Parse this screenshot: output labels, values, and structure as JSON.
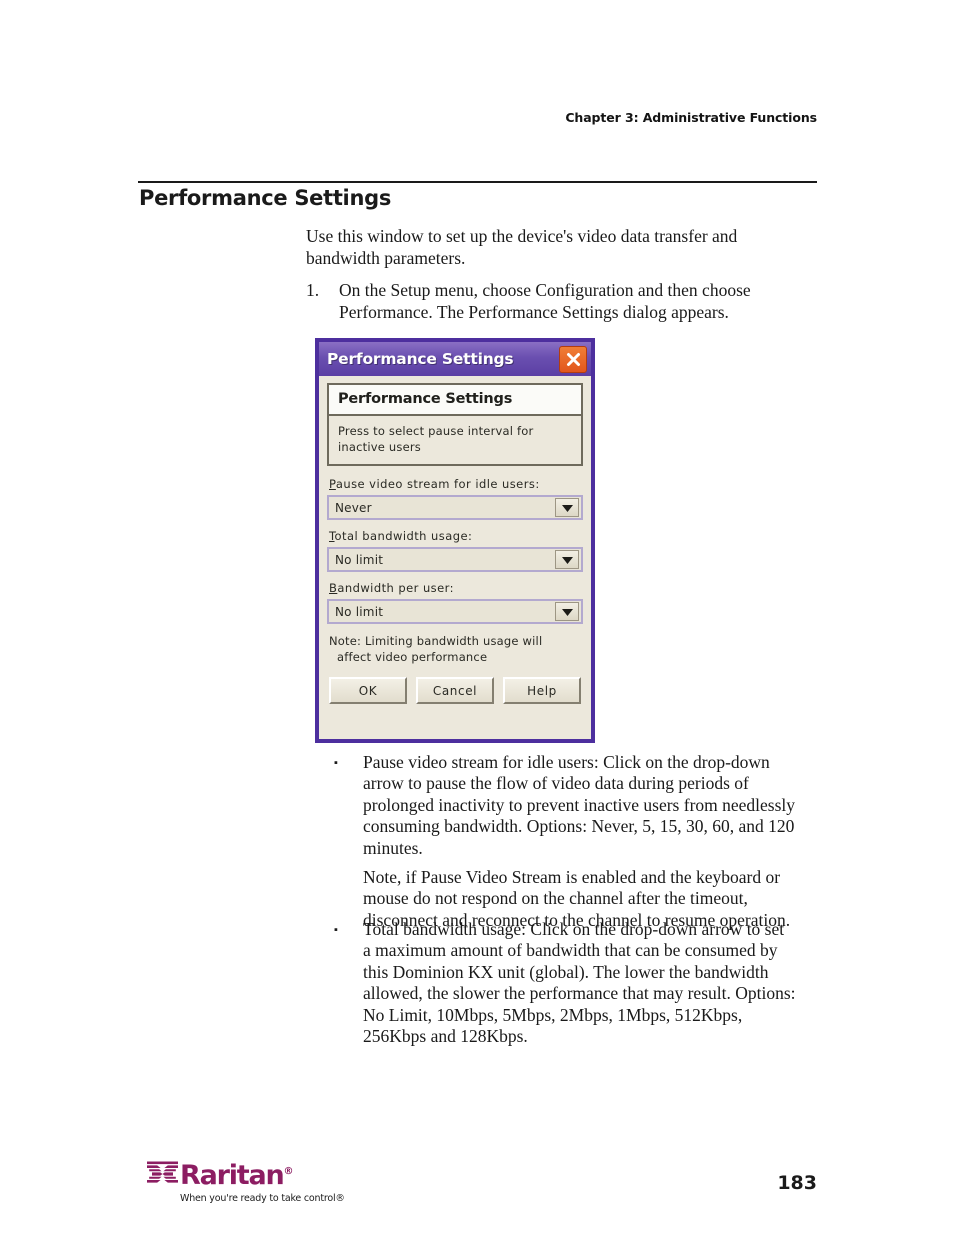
{
  "page": {
    "running_head": "Chapter 3: Administrative Functions",
    "section_title": "Performance Settings",
    "page_number": "183"
  },
  "body": {
    "intro": "Use this window to set up the device's video data transfer and bandwidth parameters.",
    "step_number": "1.",
    "step_text": "On the Setup menu, choose Configuration and then choose Performance. The Performance Settings dialog appears.",
    "bullets": [
      {
        "marker": "▪",
        "text": "Pause video stream for idle users: Click on the drop-down arrow to pause the flow of video data during periods of prolonged inactivity to prevent inactive users from needlessly consuming bandwidth. Options: Never, 5, 15, 30, 60, and 120 minutes.",
        "note": "Note, if Pause Video Stream is enabled and the keyboard or mouse do not respond on the channel after the timeout, disconnect and reconnect to the channel to resume operation."
      },
      {
        "marker": "▪",
        "text": "Total bandwidth usage: Click on the drop-down arrow to set a maximum amount of bandwidth that can be consumed by this Dominion KX unit (global). The lower the bandwidth allowed, the slower the performance that may result. Options: No Limit, 10Mbps, 5Mbps, 2Mbps, 1Mbps, 512Kbps, 256Kbps and 128Kbps."
      }
    ]
  },
  "dialog": {
    "titlebar": {
      "title": "Performance Settings",
      "close_icon": "close-x-icon"
    },
    "panel": {
      "heading": "Performance Settings",
      "hint": "Press to select pause interval for inactive users"
    },
    "fields": [
      {
        "mnemonic": "P",
        "label_rest": "ause video stream for idle users:",
        "value": "Never",
        "arrow_icon": "chevron-down-icon"
      },
      {
        "mnemonic": "T",
        "label_rest": "otal bandwidth usage:",
        "value": "No limit",
        "arrow_icon": "chevron-down-icon"
      },
      {
        "mnemonic": "B",
        "label_rest": "andwidth per user:",
        "value": "No limit",
        "arrow_icon": "chevron-down-icon"
      }
    ],
    "note_line1": "Note: Limiting bandwidth usage will",
    "note_line2": "affect video performance",
    "buttons": [
      {
        "label": "OK"
      },
      {
        "label": "Cancel"
      },
      {
        "label": "Help"
      }
    ],
    "colors": {
      "titlebar": "#5b3fa4",
      "border": "#4d2f9e",
      "surface": "#ece8dc",
      "close_button": "#e2561d",
      "combo_border": "#b3a9cf"
    }
  },
  "footer": {
    "brand": "Raritan",
    "brand_reg": "®",
    "tagline": "When you're ready to take control®",
    "logo_icon": "raritan-bowtie-logo",
    "brand_color": "#8c1d62"
  }
}
